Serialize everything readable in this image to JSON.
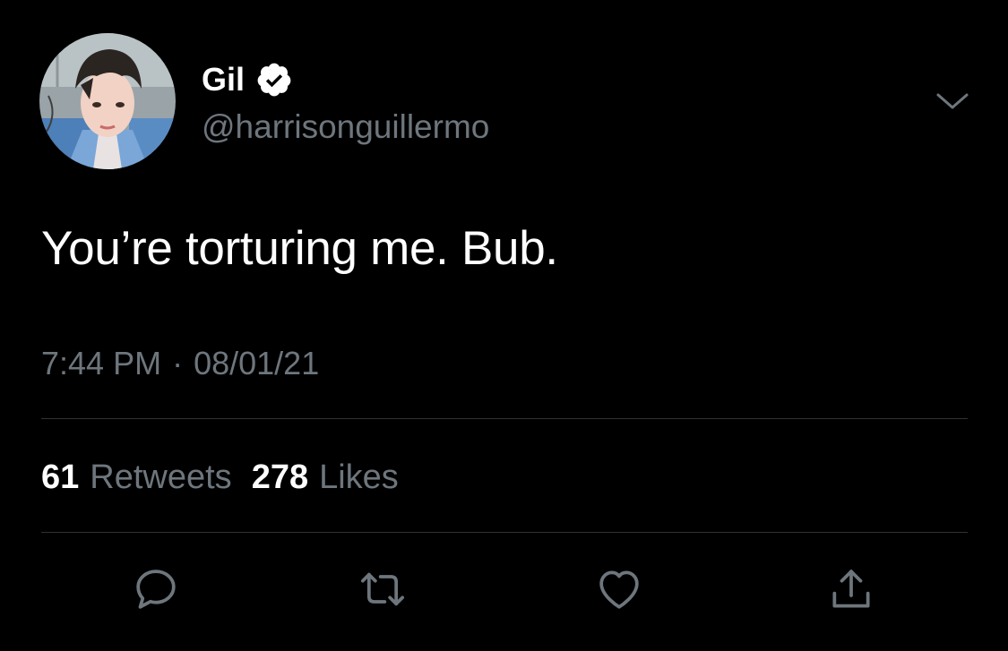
{
  "author": {
    "display_name": "Gil",
    "handle": "@harrisonguillermo",
    "verified": true
  },
  "tweet": {
    "text": "You’re torturing me. Bub.",
    "time": "7:44 PM",
    "separator": "·",
    "date": "08/01/21"
  },
  "stats": {
    "retweets_count": "61",
    "retweets_label": "Retweets",
    "likes_count": "278",
    "likes_label": "Likes"
  },
  "actions": [
    {
      "icon": "reply-icon"
    },
    {
      "icon": "retweet-icon"
    },
    {
      "icon": "like-icon"
    },
    {
      "icon": "share-icon"
    }
  ],
  "colors": {
    "background": "#000000",
    "text_primary": "#ffffff",
    "text_secondary": "#6e767d",
    "divider": "#2f3336"
  }
}
